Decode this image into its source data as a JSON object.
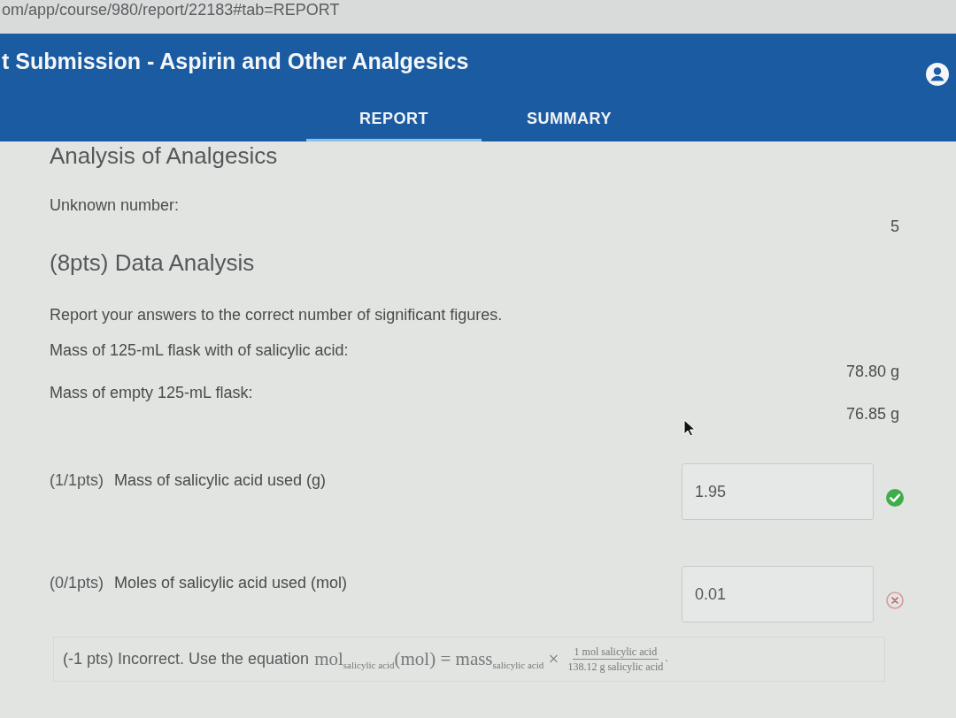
{
  "browser": {
    "url": "om/app/course/980/report/22183#tab=REPORT"
  },
  "header": {
    "title": "t Submission - Aspirin and Other Analgesics"
  },
  "tabs": [
    {
      "label": "REPORT",
      "selected": true
    },
    {
      "label": "SUMMARY",
      "selected": false
    }
  ],
  "report": {
    "title": "Analysis of Analgesics",
    "fields": [
      {
        "label": "Unknown number:",
        "value": "5"
      }
    ],
    "section": {
      "title": "(8pts) Data Analysis",
      "instructions": "Report your answers to the correct number of significant figures.",
      "data": [
        {
          "label": "Mass of 125-mL flask with of salicylic acid:",
          "value": "78.80 g"
        },
        {
          "label": "Mass of empty 125-mL flask:",
          "value": "76.85 g"
        }
      ],
      "questions": [
        {
          "points": "(1/1pts)",
          "label": "Mass of salicylic acid used (g)",
          "value": "1.95",
          "correct": true
        },
        {
          "points": "(0/1pts)",
          "label": "Moles of salicylic acid used (mol)",
          "value": "0.01",
          "correct": false,
          "feedback": {
            "message": "(-1 pts) Incorrect. Use the equation",
            "equation": "mol$_{salicylic acid}$(mol) = mass$_{salicylic acid}$ ×",
            "numerator": "1 mol salicylic acid",
            "denominator": "138.12 g salicylic acid",
            "end": "."
          }
        }
      ]
    }
  }
}
